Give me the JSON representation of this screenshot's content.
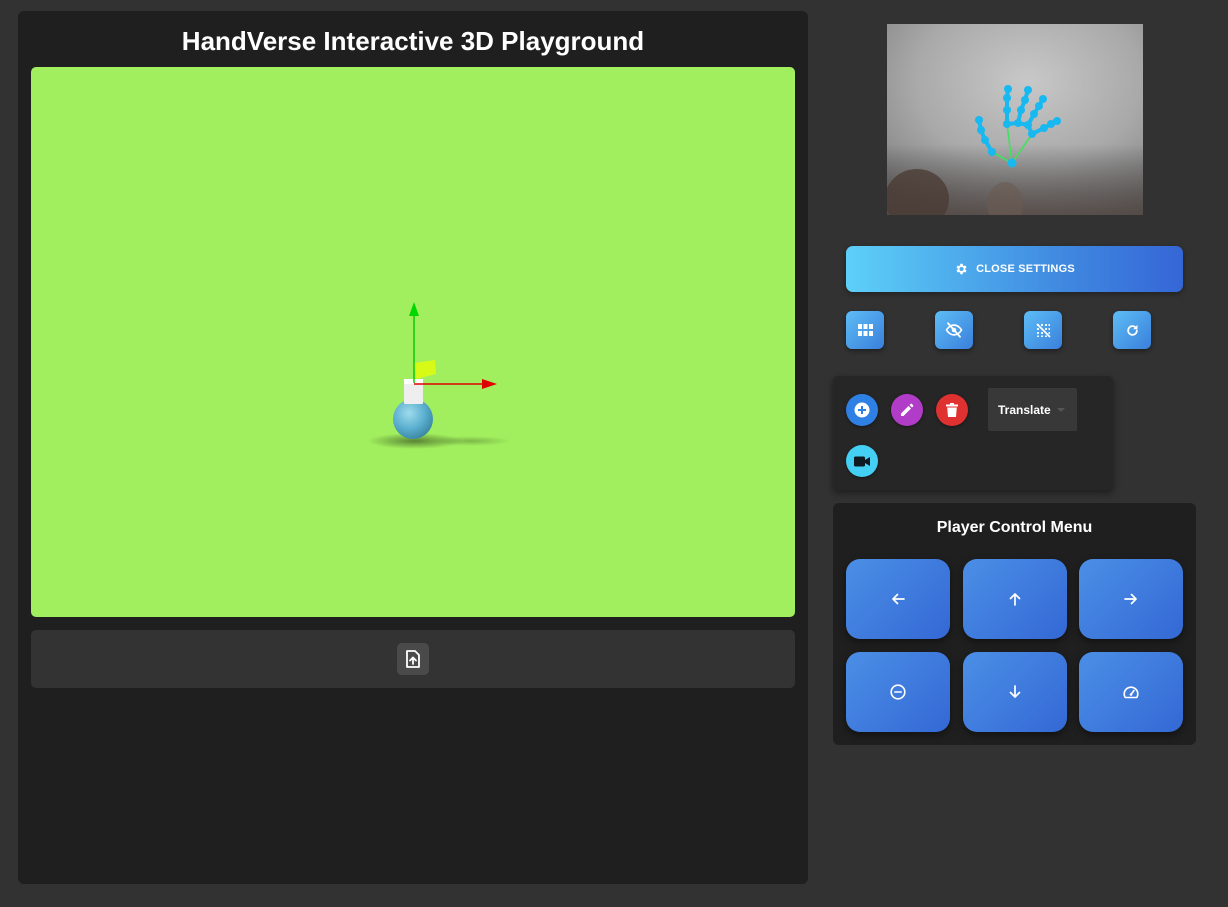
{
  "app": {
    "title": "HandVerse Interactive 3D Playground"
  },
  "viewport": {
    "background_color": "#a1ef5e",
    "gizmo": {
      "mode": "translate",
      "axis_colors": {
        "x": "#e00000",
        "y": "#00d000",
        "plane": "#f0ff00"
      }
    },
    "objects": [
      {
        "type": "sphere",
        "color": "#63b8d6"
      },
      {
        "type": "box",
        "color": "#eeeeee"
      }
    ]
  },
  "upload": {
    "icon": "file-upload-icon"
  },
  "webcam": {
    "icon": "hand-landmark-overlay",
    "landmark_color": "#18b8f0",
    "bone_color": "#40e060"
  },
  "settings": {
    "toggle_label": "CLOSE SETTINGS",
    "icon": "gear-icon"
  },
  "toolbar": {
    "buttons": [
      {
        "icon": "grid-icon"
      },
      {
        "icon": "eye-off-icon"
      },
      {
        "icon": "grid-off-icon"
      },
      {
        "icon": "refresh-icon"
      }
    ]
  },
  "object_panel": {
    "add_color": "#2f80e4",
    "edit_color": "#b03cc8",
    "delete_color": "#e03131",
    "camera_color": "#44d0f4",
    "mode_select": {
      "selected": "Translate"
    }
  },
  "player_menu": {
    "title": "Player Control Menu",
    "buttons": [
      {
        "icon": "arrow-left-icon"
      },
      {
        "icon": "arrow-up-icon"
      },
      {
        "icon": "arrow-right-icon"
      },
      {
        "icon": "minus-circle-icon"
      },
      {
        "icon": "arrow-down-icon"
      },
      {
        "icon": "speedometer-icon"
      }
    ]
  }
}
